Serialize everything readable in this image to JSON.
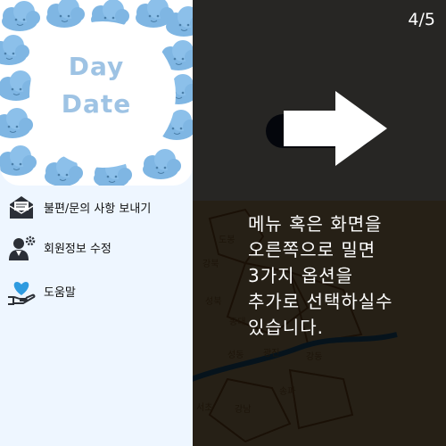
{
  "app": {
    "title_fragment": "ate",
    "map_labels": [
      "도봉",
      "강북",
      "성북",
      "동대",
      "성동",
      "광진",
      "강동",
      "송파",
      "서초",
      "강남",
      "중구"
    ]
  },
  "drawer": {
    "logo": {
      "line1": "Day",
      "line2": "Date"
    },
    "menu_items": [
      {
        "label": "불편/문의 사항 보내기",
        "icon": "mail-icon"
      },
      {
        "label": "회원정보 수정",
        "icon": "user-settings-icon"
      },
      {
        "label": "도움말",
        "icon": "heart-hand-icon"
      }
    ]
  },
  "tutorial": {
    "page_indicator": "4/5",
    "arrow": "right-arrow-icon",
    "lines": [
      "메뉴 혹은 화면을",
      "오른쪽으로 밀면",
      "3가지 옵션을",
      "추가로 선택하실수",
      "있습니다."
    ]
  },
  "colors": {
    "drawer_bg": "#eef6ff",
    "logo_text": "#9ec3e4",
    "overlay": "#1a1a1a",
    "overlay_text": "#ffffff"
  }
}
